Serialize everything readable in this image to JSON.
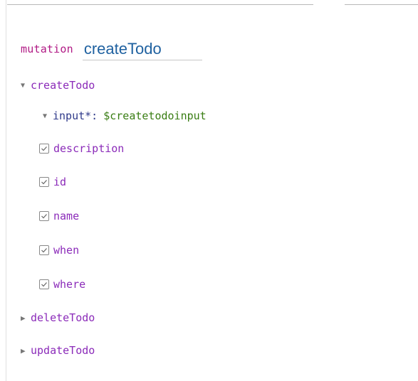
{
  "operation": {
    "keyword": "mutation",
    "name": "createTodo"
  },
  "tree": {
    "createTodo": {
      "label": "createTodo",
      "expanded": true,
      "argument": {
        "name": "input*:",
        "value": "$createtodoinput"
      },
      "fields": [
        {
          "label": "description",
          "checked": true
        },
        {
          "label": "id",
          "checked": true
        },
        {
          "label": "name",
          "checked": true
        },
        {
          "label": "when",
          "checked": true
        },
        {
          "label": "where",
          "checked": true
        }
      ]
    },
    "collapsed": [
      {
        "label": "deleteTodo"
      },
      {
        "label": "updateTodo"
      }
    ]
  },
  "icons": {
    "expanded": "triangle-down-icon",
    "collapsed": "triangle-right-icon",
    "checkbox": "checkbox-checked-icon"
  },
  "colors": {
    "keyword": "#b11a85",
    "operation_name": "#1f61a0",
    "field": "#8b2bb9",
    "argument": "#2f3a8a",
    "variable": "#397d13"
  }
}
